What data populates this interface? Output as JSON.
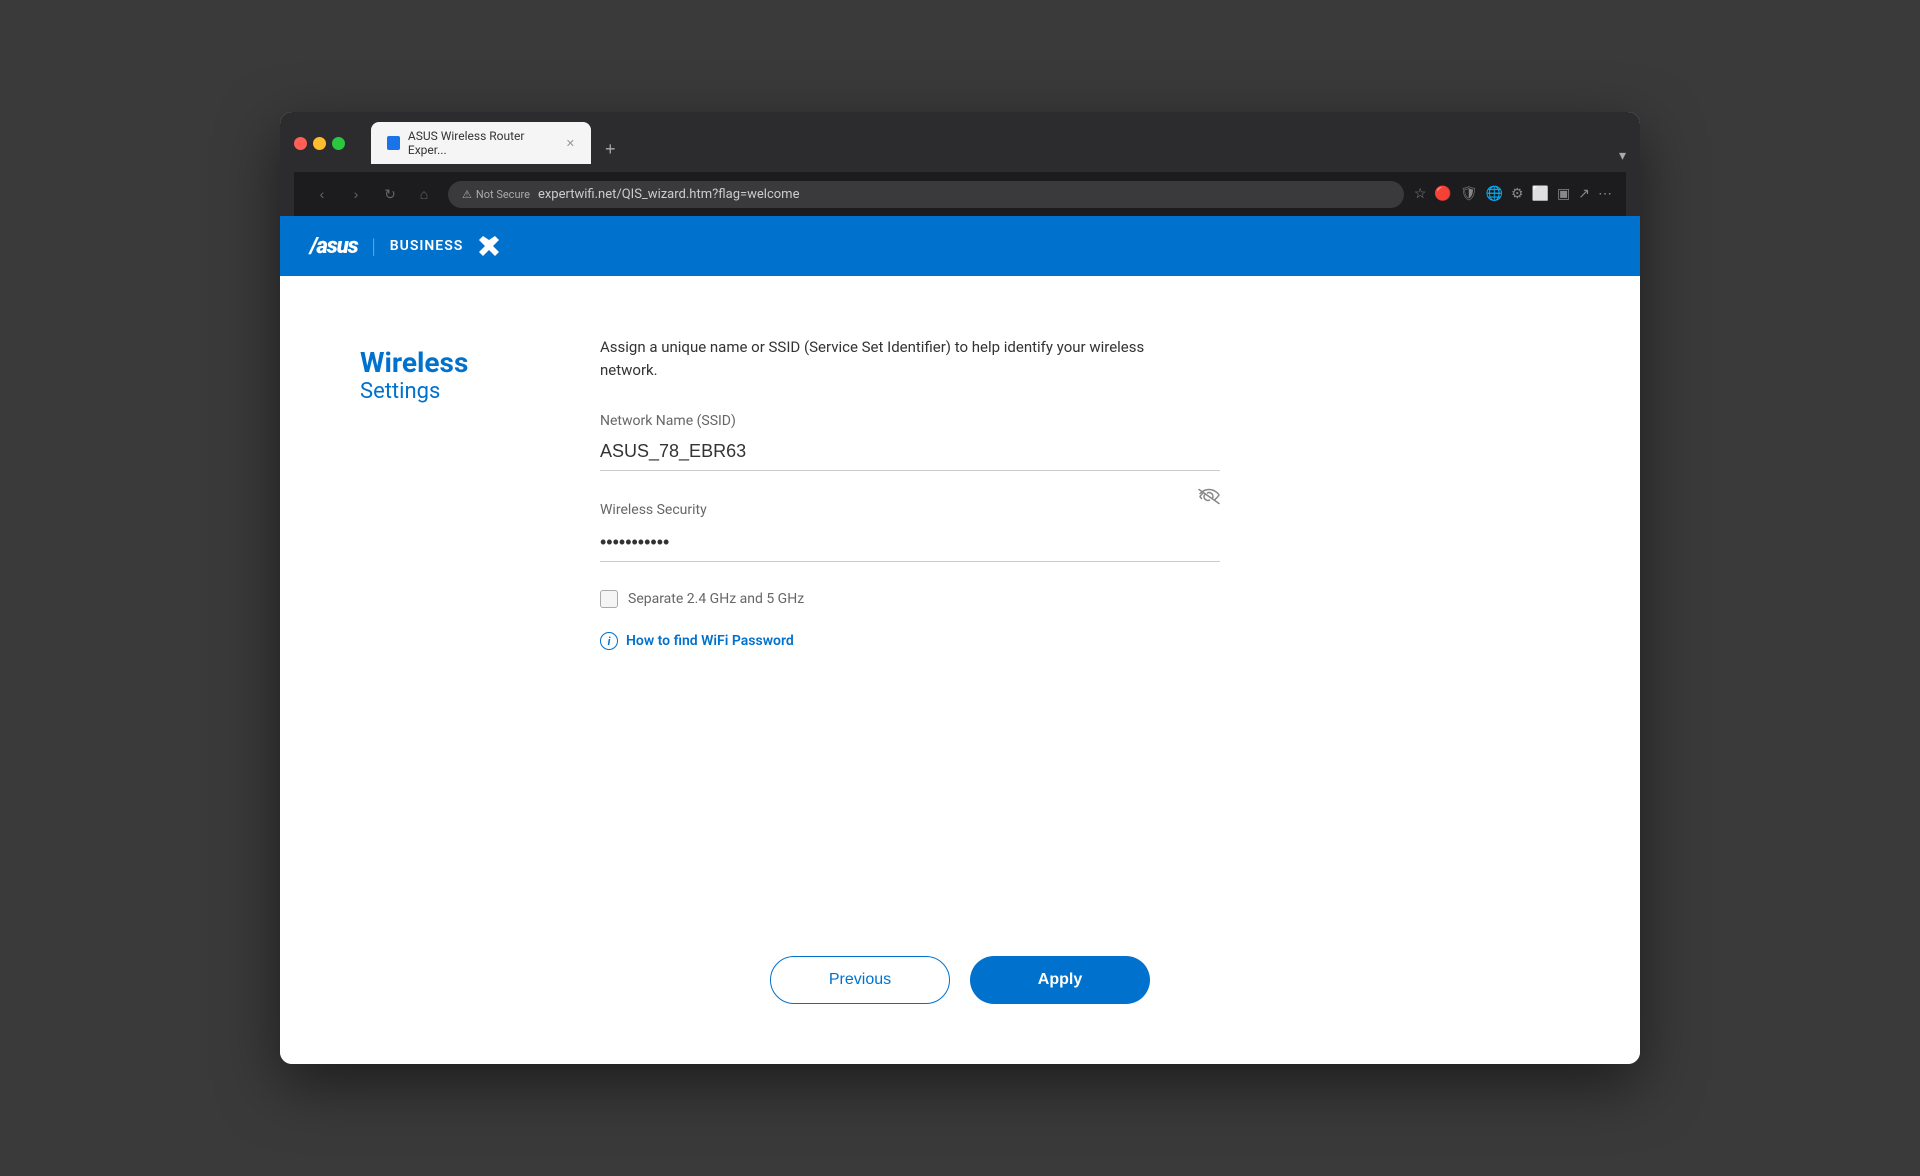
{
  "browser": {
    "tab_title": "ASUS Wireless Router Exper...",
    "tab_new_label": "+",
    "url": "expertwifi.net/QIS_wizard.htm?flag=welcome",
    "not_secure_label": "Not Secure",
    "chevron_icon": "▾"
  },
  "header": {
    "logo_text": "/asus",
    "divider": "|",
    "business_text": "BUSINESS",
    "logo_icon": "✕"
  },
  "sidebar": {
    "title": "Wireless",
    "subtitle": "Settings"
  },
  "form": {
    "description": "Assign a unique name or SSID (Service Set Identifier) to help identify your wireless network.",
    "ssid_label": "Network Name (SSID)",
    "ssid_value": "ASUS_78_EBR63",
    "security_label": "Wireless Security",
    "password_value": "••••••••••••",
    "separate_bands_label": "Separate 2.4 GHz and 5 GHz",
    "wifi_help_link": "How to find WiFi Password"
  },
  "buttons": {
    "previous_label": "Previous",
    "apply_label": "Apply"
  }
}
